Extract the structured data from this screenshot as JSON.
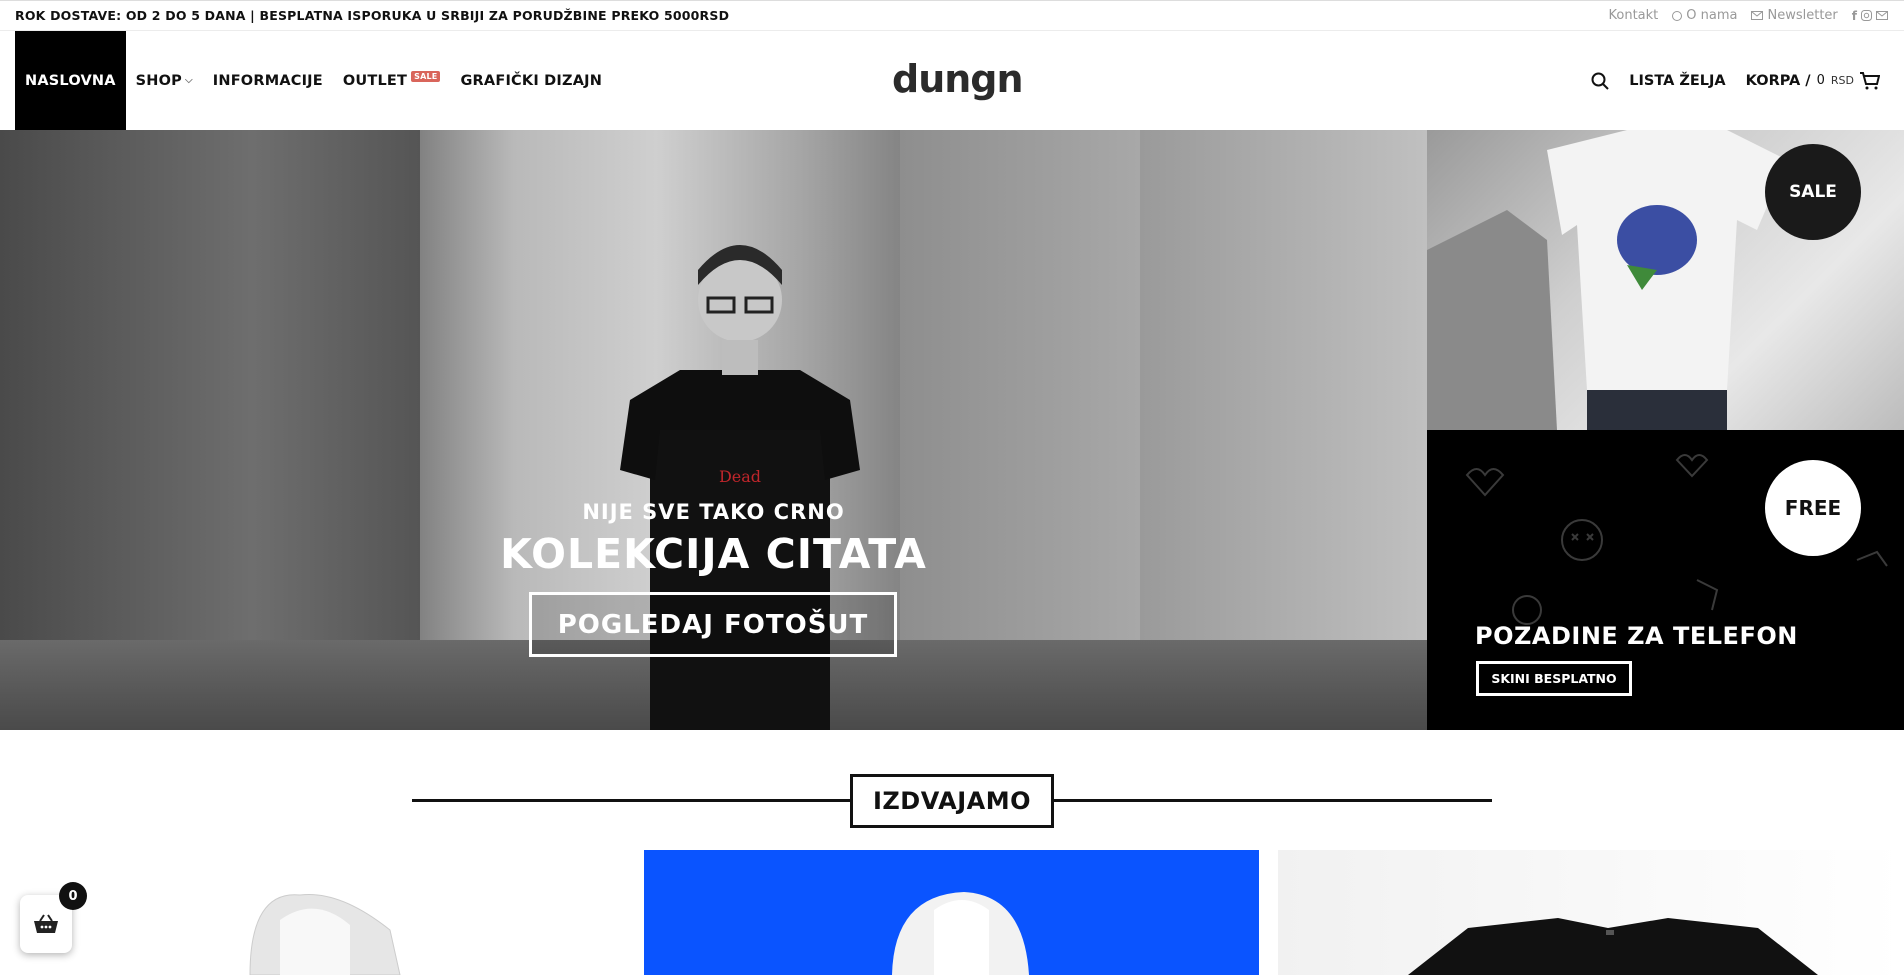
{
  "topbar": {
    "notice": "ROK DOSTAVE: OD 2 DO 5 DANA | BESPLATNA ISPORUKA U SRBIJI ZA PORUDŽBINE PREKO 5000RSD",
    "kontakt": "Kontakt",
    "o_nama": "O nama",
    "newsletter": "Newsletter"
  },
  "nav": {
    "items": [
      {
        "label": "NASLOVNA"
      },
      {
        "label": "SHOP"
      },
      {
        "label": "INFORMACIJE"
      },
      {
        "label": "OUTLET",
        "badge": "SALE"
      },
      {
        "label": "GRAFIČKI DIZAJN"
      }
    ],
    "logo": "dungn",
    "wishlist": "LISTA ŽELJA",
    "cart_label": "KORPA /",
    "cart_amount": "0",
    "cart_currency": "RSD"
  },
  "hero": {
    "subtitle": "NIJE SVE TAKO CRNO",
    "title": "KOLEKCIJA CITATA",
    "button": "POGLEDAJ FOTOŠUT",
    "shirt_print": "Dead"
  },
  "promo_top": {
    "badge": "SALE"
  },
  "promo_bottom": {
    "badge": "FREE",
    "title": "POZADINE ZA TELEFON",
    "button": "SKINI BESPLATNO"
  },
  "featured": {
    "title": "IZDVAJAMO"
  },
  "floating_cart": {
    "count": "0"
  },
  "colors": {
    "accent_sale": "#d9655b",
    "blue_product": "#0a54ff",
    "black": "#000000"
  }
}
